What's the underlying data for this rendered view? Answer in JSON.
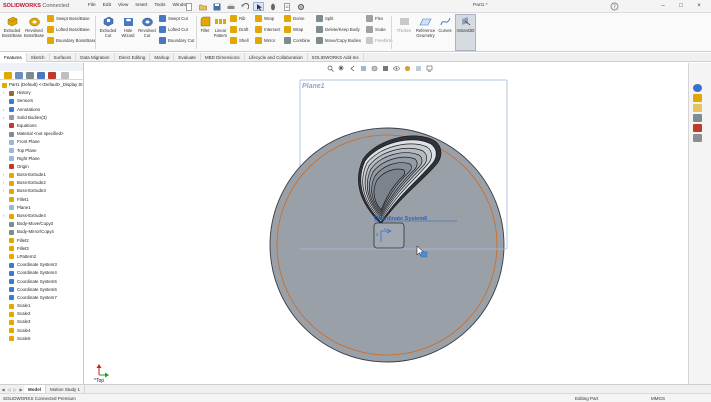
{
  "app": {
    "brand": "SOLIDWORKS",
    "brand_suffix": "Connected",
    "document_title": "Part1 *",
    "menus": [
      "File",
      "Edit",
      "View",
      "Insert",
      "Tools",
      "Window"
    ]
  },
  "ribbon": {
    "extruded_boss": "Extruded Boss/Base",
    "revolved_boss": "Revolved Boss/Base",
    "swept_boss": "Swept Boss/Base",
    "lofted_boss": "Lofted Boss/Base",
    "boundary_boss": "Boundary Boss/Base",
    "extruded_cut": "Extruded Cut",
    "hole_wizard": "Hole Wizard",
    "revolved_cut": "Revolved Cut",
    "swept_cut": "Swept Cut",
    "lofted_cut": "Lofted Cut",
    "boundary_cut": "Boundary Cut",
    "fillet": "Fillet",
    "linear_pattern": "Linear Pattern",
    "rib": "Rib",
    "draft": "Draft",
    "shell": "Shell",
    "wrap": "Wrap",
    "intersect": "Intersect",
    "mirror": "Mirror",
    "dome": "Dome",
    "wrap2": "Wrap",
    "combine": "Combine",
    "split": "Split",
    "delete_keep_body": "Delete/Keep Body",
    "move_copy_bodies": "Move/Copy Bodies",
    "flex": "Flex",
    "scale": "Scale",
    "freeform": "Freeform",
    "instant3d_alt": "Thicken",
    "reference_geometry": "Reference Geometry",
    "curves": "Curves",
    "instant3d": "Instant3D",
    "cut_with_surface": "Cut"
  },
  "tabs": [
    "Features",
    "Sketch",
    "Surfaces",
    "Data Migration",
    "Direct Editing",
    "Markup",
    "Evaluate",
    "MBD Dimensions",
    "Lifecycle and Collaboration",
    "SOLIDWORKS Add-Ins"
  ],
  "tree": {
    "root": "Part1 (Default) <<Default>_Display St",
    "items": [
      {
        "label": "History",
        "expand": true,
        "color": "#8a6d3b"
      },
      {
        "label": "Sensors",
        "expand": false,
        "color": "#3a7bd5"
      },
      {
        "label": "Annotations",
        "expand": true,
        "color": "#3a7bd5"
      },
      {
        "label": "Solid Bodies(3)",
        "expand": true,
        "color": "#9a9a9a"
      },
      {
        "label": "Equations",
        "expand": false,
        "color": "#c0392b"
      },
      {
        "label": "Material <not specified>",
        "expand": false,
        "color": "#7f8c8d"
      },
      {
        "label": "Front Plane",
        "expand": false,
        "color": "#9ab8d8"
      },
      {
        "label": "Top Plane",
        "expand": false,
        "color": "#9ab8d8"
      },
      {
        "label": "Right Plane",
        "expand": false,
        "color": "#9ab8d8"
      },
      {
        "label": "Origin",
        "expand": false,
        "color": "#c0392b"
      },
      {
        "label": "Boss-Extrude1",
        "expand": true,
        "color": "#e0a800"
      },
      {
        "label": "Boss-Extrude2",
        "expand": true,
        "color": "#e0a800"
      },
      {
        "label": "Boss-Extrude3",
        "expand": true,
        "color": "#e0a800"
      },
      {
        "label": "Fillet1",
        "expand": false,
        "color": "#e0a800"
      },
      {
        "label": "Plane1",
        "expand": false,
        "color": "#9ab8d8"
      },
      {
        "label": "Boss-Extrude4",
        "expand": true,
        "color": "#e0a800"
      },
      {
        "label": "Body-Move/Copy3",
        "expand": false,
        "color": "#7f8c8d"
      },
      {
        "label": "Body-Mirror/Copy4",
        "expand": false,
        "color": "#7f8c8d"
      },
      {
        "label": "Fillet2",
        "expand": false,
        "color": "#e0a800"
      },
      {
        "label": "Fillet3",
        "expand": false,
        "color": "#e0a800"
      },
      {
        "label": "LPattern2",
        "expand": false,
        "color": "#e0a800"
      },
      {
        "label": "Coordinate System3",
        "expand": false,
        "color": "#3a7bd5"
      },
      {
        "label": "Coordinate System4",
        "expand": false,
        "color": "#3a7bd5"
      },
      {
        "label": "Coordinate System5",
        "expand": false,
        "color": "#3a7bd5"
      },
      {
        "label": "Coordinate System6",
        "expand": false,
        "color": "#3a7bd5"
      },
      {
        "label": "Coordinate System7",
        "expand": false,
        "color": "#3a7bd5"
      },
      {
        "label": "Scale1",
        "expand": false,
        "color": "#e0a800"
      },
      {
        "label": "Scale2",
        "expand": false,
        "color": "#e0a800"
      },
      {
        "label": "Scale3",
        "expand": false,
        "color": "#e0a800"
      },
      {
        "label": "Scale4",
        "expand": false,
        "color": "#e0a800"
      },
      {
        "label": "Scale5",
        "expand": false,
        "color": "#e0a800"
      }
    ]
  },
  "viewport": {
    "plane_label": "Plane1",
    "coord_label": "Coordinate System6",
    "view_label": "*Top"
  },
  "bottom_tabs": [
    "Model",
    "Motion Study 1"
  ],
  "status": {
    "left": "SOLIDWORKS Connected Premium",
    "mode": "Editing Part",
    "units": "MMGS"
  },
  "colors": {
    "brand": "#c8102e",
    "disc": "#9aa0a8",
    "orange_circle": "#d2691e",
    "plane_frame": "#7f9fd0",
    "selection": "#2a6fdb"
  }
}
